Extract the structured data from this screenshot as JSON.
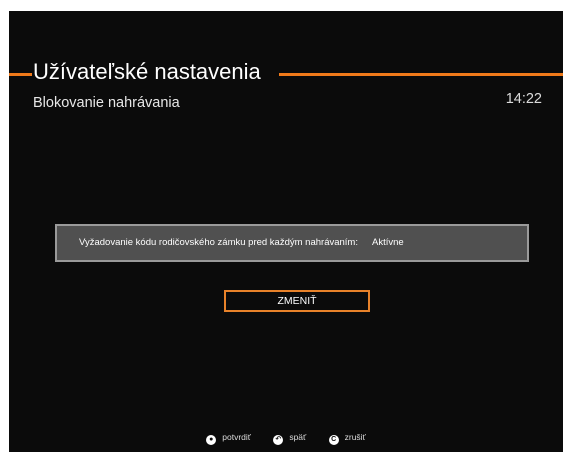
{
  "header": {
    "title": "Užívateľské nastavenia",
    "subtitle": "Blokovanie nahrávania",
    "clock": "14:22"
  },
  "colors": {
    "accent": "#f07a1a",
    "background": "#0b0b0b",
    "setting_bar": "#505050"
  },
  "setting": {
    "label": "Vyžadovanie kódu rodičovského zámku pred každým nahrávaním:",
    "value": "Aktívne"
  },
  "change_button": {
    "label": "ZMENIŤ"
  },
  "footer": {
    "hints": [
      {
        "icon": "ok-icon",
        "label": "potvrdiť"
      },
      {
        "icon": "back-icon",
        "label": "späť"
      },
      {
        "icon": "cancel-icon",
        "label": "zrušiť"
      }
    ]
  }
}
